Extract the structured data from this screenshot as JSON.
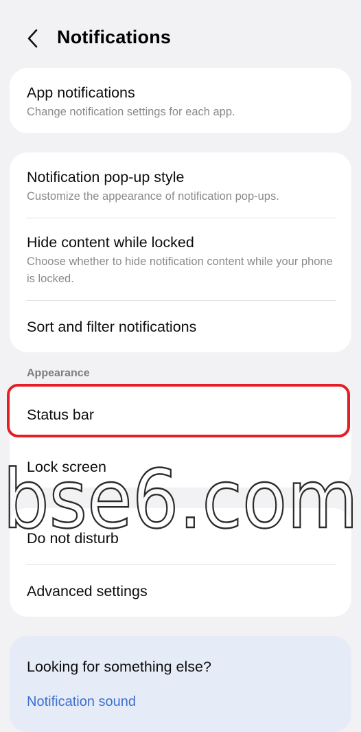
{
  "header": {
    "title": "Notifications",
    "back_icon": "chevron-left-icon"
  },
  "card1": {
    "app_notifications": {
      "title": "App notifications",
      "subtitle": "Change notification settings for each app."
    }
  },
  "card2": {
    "popup_style": {
      "title": "Notification pop-up style",
      "subtitle": "Customize the appearance of notification pop-ups."
    },
    "hide_content": {
      "title": "Hide content while locked",
      "subtitle": "Choose whether to hide notification content while your phone is locked."
    },
    "sort_filter": {
      "title": "Sort and filter notifications"
    }
  },
  "appearance": {
    "label": "Appearance",
    "status_bar": "Status bar",
    "lock_screen": "Lock screen"
  },
  "card4": {
    "do_not_disturb": "Do not disturb",
    "advanced": "Advanced settings"
  },
  "looking": {
    "title": "Looking for something else?",
    "link": "Notification sound"
  },
  "watermark": {
    "text": "bse6.com"
  },
  "colors": {
    "background": "#f2f2f4",
    "card": "#ffffff",
    "highlight": "#e41e24",
    "link": "#3e6fcf",
    "looking_card": "#e6ecf7"
  }
}
